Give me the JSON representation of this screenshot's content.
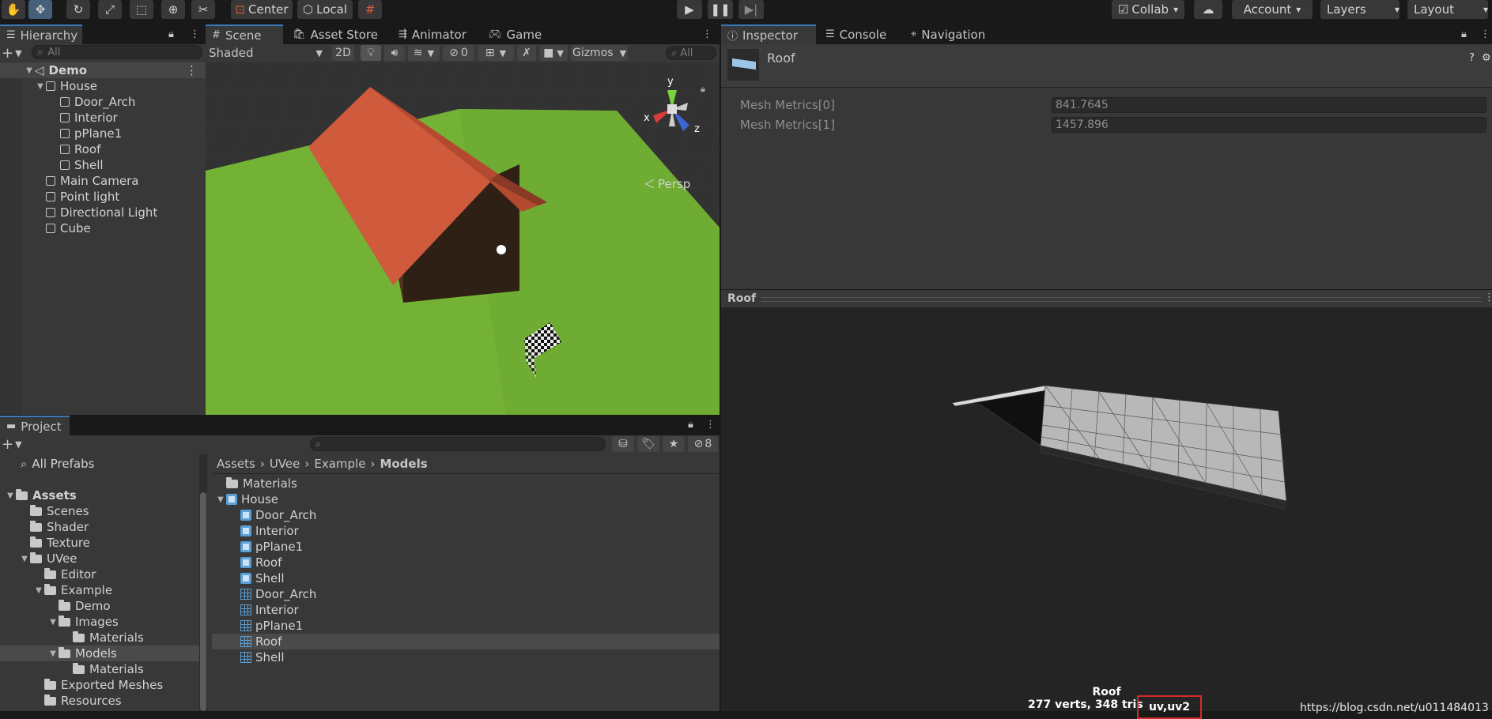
{
  "toolbar": {
    "tools": [
      "hand-icon",
      "move-icon",
      "rotate-icon",
      "scale-icon",
      "rect-icon",
      "transform-icon",
      "custom-tool-icon"
    ],
    "pivot_label": "Center",
    "space_label": "Local",
    "collab_label": "Collab",
    "account_label": "Account",
    "layers_label": "Layers",
    "layout_label": "Layout"
  },
  "hierarchy": {
    "tab_label": "Hierarchy",
    "search_placeholder": "All",
    "scene_name": "Demo",
    "items": [
      {
        "label": "House",
        "depth": 1,
        "arrow": "▼"
      },
      {
        "label": "Door_Arch",
        "depth": 2,
        "arrow": ""
      },
      {
        "label": "Interior",
        "depth": 2,
        "arrow": ""
      },
      {
        "label": "pPlane1",
        "depth": 2,
        "arrow": ""
      },
      {
        "label": "Roof",
        "depth": 2,
        "arrow": ""
      },
      {
        "label": "Shell",
        "depth": 2,
        "arrow": ""
      },
      {
        "label": "Main Camera",
        "depth": 1,
        "arrow": ""
      },
      {
        "label": "Point light",
        "depth": 1,
        "arrow": ""
      },
      {
        "label": "Directional Light",
        "depth": 1,
        "arrow": ""
      },
      {
        "label": "Cube",
        "depth": 1,
        "arrow": ""
      }
    ]
  },
  "scene": {
    "tabs": [
      "Scene",
      "Asset Store",
      "Animator",
      "Game"
    ],
    "shading_mode": "Shaded",
    "btn_2d": "2D",
    "hidden_count": "0",
    "gizmos_label": "Gizmos",
    "search_placeholder": "All",
    "persp_label": "Persp",
    "axis_x": "x",
    "axis_y": "y",
    "axis_z": "z"
  },
  "project": {
    "tab_label": "Project",
    "hidden_count": "8",
    "favorites": [
      {
        "label": "All Prefabs"
      }
    ],
    "tree": [
      {
        "label": "Assets",
        "depth": 0,
        "arrow": "▼",
        "bold": true
      },
      {
        "label": "Scenes",
        "depth": 1,
        "arrow": ""
      },
      {
        "label": "Shader",
        "depth": 1,
        "arrow": ""
      },
      {
        "label": "Texture",
        "depth": 1,
        "arrow": ""
      },
      {
        "label": "UVee",
        "depth": 1,
        "arrow": "▼"
      },
      {
        "label": "Editor",
        "depth": 2,
        "arrow": ""
      },
      {
        "label": "Example",
        "depth": 2,
        "arrow": "▼"
      },
      {
        "label": "Demo",
        "depth": 3,
        "arrow": ""
      },
      {
        "label": "Images",
        "depth": 3,
        "arrow": "▼"
      },
      {
        "label": "Materials",
        "depth": 4,
        "arrow": ""
      },
      {
        "label": "Models",
        "depth": 3,
        "arrow": "▼",
        "selected": true
      },
      {
        "label": "Materials",
        "depth": 4,
        "arrow": ""
      },
      {
        "label": "Exported Meshes",
        "depth": 2,
        "arrow": ""
      },
      {
        "label": "Resources",
        "depth": 2,
        "arrow": ""
      }
    ],
    "breadcrumb": [
      "Assets",
      "UVee",
      "Example",
      "Models"
    ],
    "files": [
      {
        "label": "Materials",
        "kind": "folder",
        "depth": 0
      },
      {
        "label": "House",
        "kind": "prefab",
        "depth": 0,
        "arrow": "▼"
      },
      {
        "label": "Door_Arch",
        "kind": "prefab",
        "depth": 1
      },
      {
        "label": "Interior",
        "kind": "prefab",
        "depth": 1
      },
      {
        "label": "pPlane1",
        "kind": "prefab",
        "depth": 1
      },
      {
        "label": "Roof",
        "kind": "prefab",
        "depth": 1
      },
      {
        "label": "Shell",
        "kind": "prefab",
        "depth": 1
      },
      {
        "label": "Door_Arch",
        "kind": "mesh",
        "depth": 1
      },
      {
        "label": "Interior",
        "kind": "mesh",
        "depth": 1
      },
      {
        "label": "pPlane1",
        "kind": "mesh",
        "depth": 1
      },
      {
        "label": "Roof",
        "kind": "mesh",
        "depth": 1,
        "selected": true
      },
      {
        "label": "Shell",
        "kind": "mesh",
        "depth": 1
      }
    ]
  },
  "inspector": {
    "tabs": [
      "Inspector",
      "Console",
      "Navigation"
    ],
    "object_name": "Roof",
    "fields": [
      {
        "label": "Mesh Metrics[0]",
        "value": "841.7645"
      },
      {
        "label": "Mesh Metrics[1]",
        "value": "1457.896"
      }
    ],
    "preview_title": "Roof",
    "preview_name": "Roof",
    "preview_stats": "277 verts, 348 tris",
    "preview_uv": "uv,uv2",
    "watermark": "https://blog.csdn.net/u011484013"
  },
  "colors": {
    "accent": "#3a79bb",
    "highlight_box": "#d42a2a",
    "roof": "#d75c3f",
    "grass": "#74b236"
  }
}
